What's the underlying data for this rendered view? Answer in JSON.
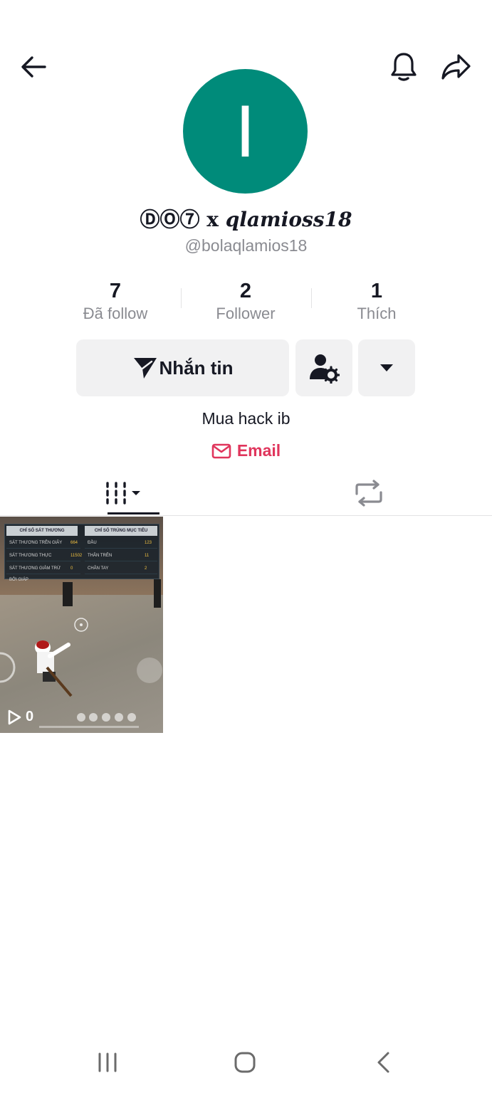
{
  "header": {
    "back_icon": "arrow-left-icon",
    "bell_icon": "bell-icon",
    "share_icon": "share-arrow-icon"
  },
  "profile": {
    "avatar_letter": "I",
    "avatar_color": "#008b7a",
    "display_name_prefix": "ⒹⓄ⑦ x ",
    "display_name_suffix": "qlamioss18",
    "username": "@bolaqlamios18"
  },
  "stats": [
    {
      "value": "7",
      "label": "Đã follow"
    },
    {
      "value": "2",
      "label": "Follower"
    },
    {
      "value": "1",
      "label": "Thích"
    }
  ],
  "actions": {
    "message_label": "Nhắn tin",
    "message_icon": "send-icon",
    "settings_icon": "user-gear-icon",
    "more_icon": "caret-down-icon"
  },
  "bio": "Mua hack ib",
  "email_label": "Email",
  "email_color": "#e0355c",
  "tabs": {
    "videos_icon": "grid-bars-icon",
    "repost_icon": "repost-icon"
  },
  "videos": [
    {
      "views": "0",
      "hud": {
        "left_title": "CHỈ SỐ SÁT THƯƠNG",
        "right_title": "CHỈ SỐ TRÚNG MỤC TIÊU",
        "left_rows": [
          {
            "label": "SÁT THƯƠNG TRÊN GIÂY",
            "value": "664"
          },
          {
            "label": "SÁT THƯƠNG THỰC",
            "value": "11502"
          },
          {
            "label": "SÁT THƯƠNG GIẢM TRỪ BỞI GIÁP",
            "value": "0"
          }
        ],
        "right_rows": [
          {
            "label": "ĐẦU",
            "value": "123"
          },
          {
            "label": "THÂN TRÊN",
            "value": "11"
          },
          {
            "label": "CHÂN TAY",
            "value": "2"
          }
        ]
      }
    }
  ]
}
